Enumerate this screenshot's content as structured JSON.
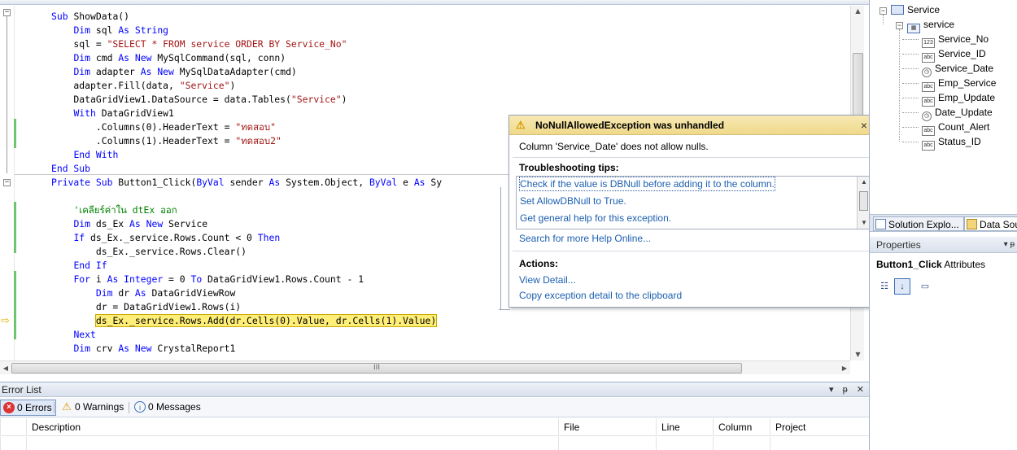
{
  "code": {
    "lines": [
      [
        {
          "t": "Sub ",
          "c": "kw"
        },
        {
          "t": "ShowData()"
        }
      ],
      [
        {
          "t": "    "
        },
        {
          "t": "Dim ",
          "c": "kw"
        },
        {
          "t": "sql "
        },
        {
          "t": "As ",
          "c": "kw"
        },
        {
          "t": "String",
          "c": "kw"
        }
      ],
      [
        {
          "t": "    sql = "
        },
        {
          "t": "\"SELECT * FROM service ORDER BY Service_No\"",
          "c": "str"
        }
      ],
      [
        {
          "t": "    "
        },
        {
          "t": "Dim ",
          "c": "kw"
        },
        {
          "t": "cmd "
        },
        {
          "t": "As New ",
          "c": "kw"
        },
        {
          "t": "MySqlCommand(sql, conn)"
        }
      ],
      [
        {
          "t": "    "
        },
        {
          "t": "Dim ",
          "c": "kw"
        },
        {
          "t": "adapter "
        },
        {
          "t": "As New ",
          "c": "kw"
        },
        {
          "t": "MySqlDataAdapter(cmd)"
        }
      ],
      [
        {
          "t": "    adapter.Fill(data, "
        },
        {
          "t": "\"Service\"",
          "c": "str"
        },
        {
          "t": ")"
        }
      ],
      [
        {
          "t": "    DataGridView1.DataSource = data.Tables("
        },
        {
          "t": "\"Service\"",
          "c": "str"
        },
        {
          "t": ")"
        }
      ],
      [
        {
          "t": "    "
        },
        {
          "t": "With ",
          "c": "kw"
        },
        {
          "t": "DataGridView1"
        }
      ],
      [
        {
          "t": "        .Columns(0).HeaderText = "
        },
        {
          "t": "\"ทดสอบ\"",
          "c": "str"
        }
      ],
      [
        {
          "t": "        .Columns(1).HeaderText = "
        },
        {
          "t": "\"ทดสอบ2\"",
          "c": "str"
        }
      ],
      [
        {
          "t": "    "
        },
        {
          "t": "End With",
          "c": "kw"
        }
      ],
      [
        {
          "t": "End Sub",
          "c": "kw"
        }
      ],
      [
        {
          "t": "Private Sub ",
          "c": "kw"
        },
        {
          "t": "Button1_Click(",
          "c": ""
        },
        {
          "t": "ByVal ",
          "c": "kw"
        },
        {
          "t": "sender "
        },
        {
          "t": "As ",
          "c": "kw"
        },
        {
          "t": "System.Object, "
        },
        {
          "t": "ByVal ",
          "c": "kw"
        },
        {
          "t": "e "
        },
        {
          "t": "As ",
          "c": "kw"
        },
        {
          "t": "Sy"
        }
      ],
      [],
      [
        {
          "t": "    "
        },
        {
          "t": "'เคลียร์ค่าใน dtEx ออก",
          "c": "cmt"
        }
      ],
      [
        {
          "t": "    "
        },
        {
          "t": "Dim ",
          "c": "kw"
        },
        {
          "t": "ds_Ex "
        },
        {
          "t": "As New ",
          "c": "kw"
        },
        {
          "t": "Service"
        }
      ],
      [
        {
          "t": "    "
        },
        {
          "t": "If ",
          "c": "kw"
        },
        {
          "t": "ds_Ex._service.Rows.Count < 0 "
        },
        {
          "t": "Then",
          "c": "kw"
        }
      ],
      [
        {
          "t": "        ds_Ex._service.Rows.Clear()"
        }
      ],
      [
        {
          "t": "    "
        },
        {
          "t": "End If",
          "c": "kw"
        }
      ],
      [
        {
          "t": "    "
        },
        {
          "t": "For ",
          "c": "kw"
        },
        {
          "t": "i "
        },
        {
          "t": "As Integer ",
          "c": "kw"
        },
        {
          "t": "= 0 "
        },
        {
          "t": "To ",
          "c": "kw"
        },
        {
          "t": "DataGridView1.Rows.Count - 1"
        }
      ],
      [
        {
          "t": "        "
        },
        {
          "t": "Dim ",
          "c": "kw"
        },
        {
          "t": "dr "
        },
        {
          "t": "As ",
          "c": "kw"
        },
        {
          "t": "DataGridViewRow"
        }
      ],
      [
        {
          "t": "        dr = DataGridView1.Rows(i)"
        }
      ],
      [
        {
          "t": "        "
        },
        {
          "t": "ds_Ex._service.Rows.Add(dr.Cells(0).Value, dr.Cells(1).Value)",
          "c": "hl"
        }
      ],
      [
        {
          "t": "    "
        },
        {
          "t": "Next",
          "c": "kw"
        }
      ],
      [
        {
          "t": "    "
        },
        {
          "t": "Dim ",
          "c": "kw"
        },
        {
          "t": "crv "
        },
        {
          "t": "As New ",
          "c": "kw"
        },
        {
          "t": "CrystalReport1"
        }
      ]
    ],
    "hscroll_grip": "III"
  },
  "exception": {
    "title": "NoNullAllowedException was unhandled",
    "message": "Column 'Service_Date' does not allow nulls.",
    "tips_heading": "Troubleshooting tips:",
    "tips": [
      "Check if the value is DBNull before adding it to the column.",
      "Set AllowDBNull to True.",
      "Get general help for this exception."
    ],
    "search": "Search for more Help Online...",
    "actions_heading": "Actions:",
    "actions": [
      "View Detail...",
      "Copy exception detail to the clipboard"
    ],
    "close": "×",
    "warn_icon": "⚠"
  },
  "error_list": {
    "title": "Error List",
    "controls": [
      "▾",
      "ᵽ",
      "✕"
    ],
    "errors": "0 Errors",
    "warnings": "0 Warnings",
    "messages": "0 Messages",
    "columns": [
      "Description",
      "File",
      "Line",
      "Column",
      "Project"
    ]
  },
  "data_sources": {
    "root": "Service",
    "table": "service",
    "fields": [
      {
        "name": "Service_No",
        "icon": "123"
      },
      {
        "name": "Service_ID",
        "icon": "abc"
      },
      {
        "name": "Service_Date",
        "icon": "clock"
      },
      {
        "name": "Emp_Service",
        "icon": "abc"
      },
      {
        "name": "Emp_Update",
        "icon": "abc"
      },
      {
        "name": "Date_Update",
        "icon": "clock"
      },
      {
        "name": "Count_Alert",
        "icon": "abc"
      },
      {
        "name": "Status_ID",
        "icon": "abc"
      }
    ]
  },
  "tabs": {
    "solution": "Solution Explo...",
    "data": "Data Sou"
  },
  "properties": {
    "title": "Properties",
    "object_name": "Button1_Click",
    "object_type": "Attributes",
    "pin": "▾ ᵽ"
  },
  "colors": {
    "keyword": "#0000ff",
    "string": "#a31515",
    "comment": "#008000",
    "highlight": "#ffef79",
    "link": "#1c5fb0"
  }
}
